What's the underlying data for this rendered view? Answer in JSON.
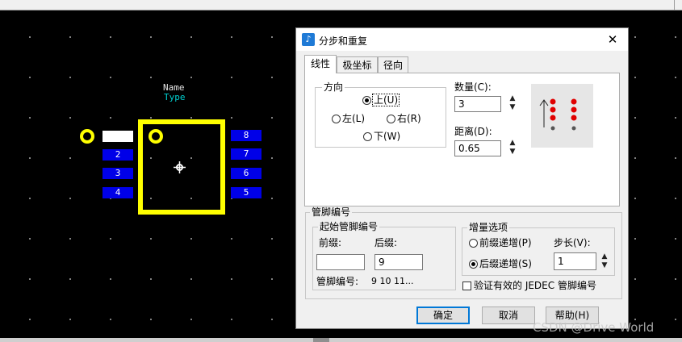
{
  "component": {
    "name_label": "Name",
    "type_label": "Type",
    "left_pads": [
      "",
      "2",
      "3",
      "4"
    ],
    "right_pads": [
      "8",
      "7",
      "6",
      "5"
    ]
  },
  "dialog": {
    "title": "分步和重复",
    "close_glyph": "✕",
    "tabs": [
      "线性",
      "极坐标",
      "径向"
    ],
    "direction": {
      "label": "方向",
      "up": "上(U)",
      "left": "左(L)",
      "right": "右(R)",
      "down": "下(W)",
      "selected": "up"
    },
    "count": {
      "label": "数量(C):",
      "value": "3"
    },
    "distance": {
      "label": "距离(D):",
      "value": "0.65"
    },
    "pin_numbering": {
      "label": "管脚编号",
      "start_group_label": "起始管脚编号",
      "prefix_label": "前缀:",
      "prefix_value": "",
      "suffix_label": "后缀:",
      "suffix_value": "9",
      "pin_number_label": "管脚编号:",
      "pin_number_value": "9 10 11..."
    },
    "increment": {
      "label": "增量选项",
      "prefix_inc": "前缀递增(P)",
      "suffix_inc": "后缀递增(S)",
      "selected": "suffix",
      "step_label": "步长(V):",
      "step_value": "1",
      "verify_label": "验证有效的 JEDEC 管脚编号",
      "verify_checked": false
    },
    "buttons": {
      "ok": "确定",
      "cancel": "取消",
      "help": "帮助(H)"
    }
  },
  "watermark": "CSDN @Drive World",
  "colors": {
    "pad_blue": "#0000e8",
    "outline_yellow": "#ffff00",
    "name_text": "#e6e6e6",
    "type_text": "#00d2d2",
    "preview_red": "#e00000"
  }
}
